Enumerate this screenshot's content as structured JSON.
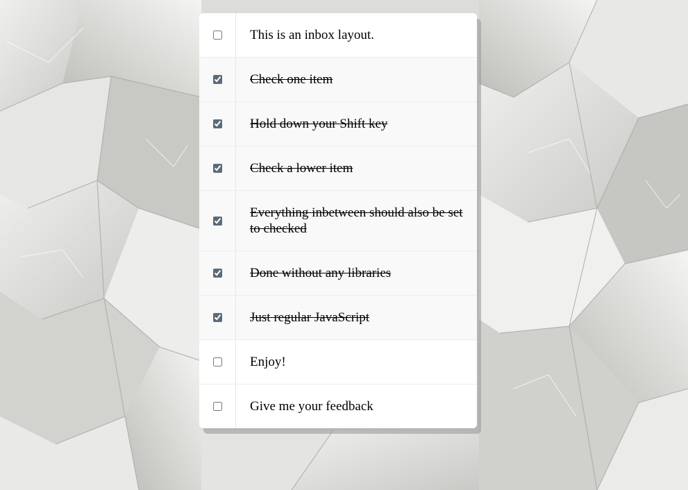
{
  "items": [
    {
      "text": "This is an inbox layout.",
      "checked": false
    },
    {
      "text": "Check one item",
      "checked": true
    },
    {
      "text": "Hold down your Shift key",
      "checked": true
    },
    {
      "text": "Check a lower item",
      "checked": true
    },
    {
      "text": "Everything inbetween should also be set to checked",
      "checked": true
    },
    {
      "text": "Done without any libraries",
      "checked": true
    },
    {
      "text": "Just regular JavaScript",
      "checked": true
    },
    {
      "text": "Enjoy!",
      "checked": false
    },
    {
      "text": "Give me your feedback",
      "checked": false
    }
  ]
}
